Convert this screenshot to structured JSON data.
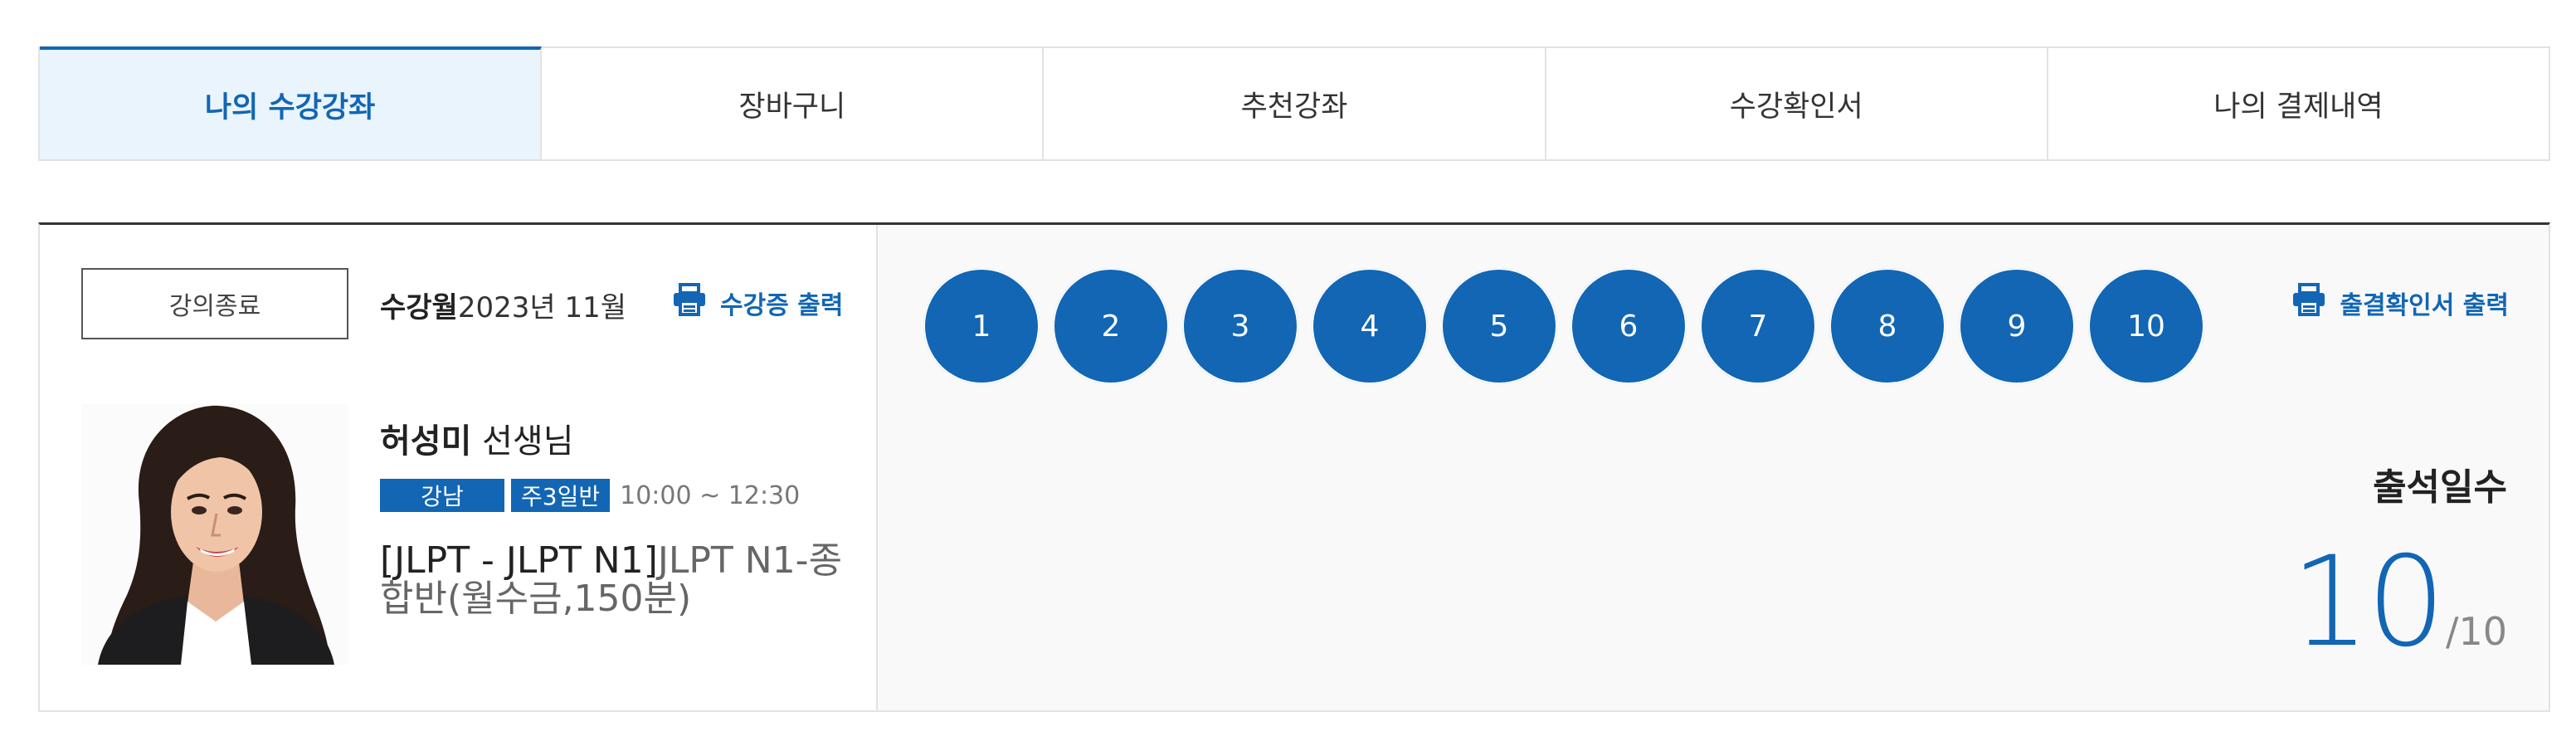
{
  "tabs": [
    {
      "label": "나의 수강강좌",
      "active": true
    },
    {
      "label": "장바구니",
      "active": false
    },
    {
      "label": "추천강좌",
      "active": false
    },
    {
      "label": "수강확인서",
      "active": false
    },
    {
      "label": "나의 결제내역",
      "active": false
    }
  ],
  "course": {
    "status": "강의종료",
    "month_label": "수강월",
    "month_value": "2023년 11월",
    "print_certificate": "수강증 출력",
    "teacher_name": "허성미",
    "teacher_suffix": "선생님",
    "badges": [
      "강남",
      "주3일반"
    ],
    "time": "10:00 ~ 12:30",
    "title_code": "[JLPT - JLPT N1]",
    "title_text": "JLPT N1-종합반(월수금,150분)"
  },
  "attendance": {
    "sessions": [
      "1",
      "2",
      "3",
      "4",
      "5",
      "6",
      "7",
      "8",
      "9",
      "10"
    ],
    "print_label": "출결확인서 출력",
    "label": "출석일수",
    "count": "10",
    "total": "/10"
  },
  "colors": {
    "accent": "#1266b4",
    "tab_active_bg": "#eaf4fd",
    "attendance_bg": "#f9f9f9"
  },
  "icons": {
    "print": "printer-icon"
  }
}
